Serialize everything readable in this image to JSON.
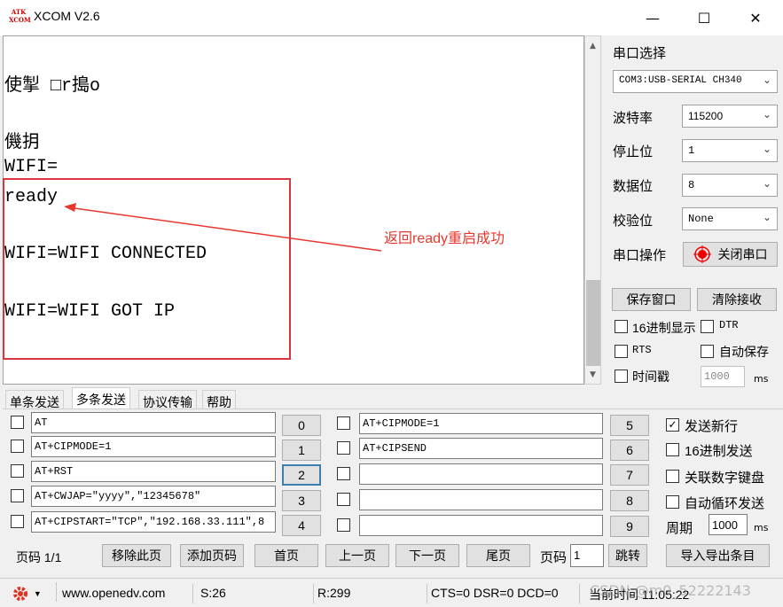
{
  "window": {
    "logo_text": "ATK\nXCOM",
    "title": "XCOM V2.6",
    "minimize": "—",
    "maximize": "☐",
    "close": "✕"
  },
  "receive": {
    "lines": [
      "使掣 □r搗o",
      "",
      "僟抈",
      "WIFI=",
      "ready",
      "",
      "WIFI=WIFI CONNECTED",
      "",
      "WIFI=WIFI GOT IP"
    ],
    "annotation": "返回ready重启成功"
  },
  "settings": {
    "port_label": "串口选择",
    "port_value": "COM3:USB-SERIAL CH340",
    "baud_label": "波特率",
    "baud_value": "115200",
    "stop_label": "停止位",
    "stop_value": "1",
    "data_label": "数据位",
    "data_value": "8",
    "parity_label": "校验位",
    "parity_value": "None",
    "op_label": "串口操作",
    "op_button": "关闭串口",
    "save_window": "保存窗口",
    "clear_recv": "清除接收",
    "hex_display": "16进制显示",
    "dtr": "DTR",
    "rts": "RTS",
    "auto_save": "自动保存",
    "timestamp": "时间戳",
    "timestamp_value": "1000",
    "ms": "ms"
  },
  "tabs": [
    "单条发送",
    "多条发送",
    "协议传输",
    "帮助"
  ],
  "multi_send": {
    "left": [
      {
        "text": "AT",
        "num": "0"
      },
      {
        "text": "AT+CIPMODE=1",
        "num": "1"
      },
      {
        "text": "AT+RST",
        "num": "2"
      },
      {
        "text": "AT+CWJAP=\"yyyy\",\"12345678\"",
        "num": "3"
      },
      {
        "text": "AT+CIPSTART=\"TCP\",\"192.168.33.111\",8",
        "num": "4"
      }
    ],
    "right": [
      {
        "text": "AT+CIPMODE=1",
        "num": "5"
      },
      {
        "text": "AT+CIPSEND",
        "num": "6"
      },
      {
        "text": "",
        "num": "7"
      },
      {
        "text": "",
        "num": "8"
      },
      {
        "text": "",
        "num": "9"
      }
    ],
    "send_newline": "发送新行",
    "hex_send": "16进制发送",
    "link_keypad": "关联数字键盘",
    "auto_loop": "自动循环发送",
    "period_label": "周期",
    "period_value": "1000",
    "ms": "ms",
    "page_label": "页码 1/1",
    "remove_page": "移除此页",
    "add_page": "添加页码",
    "first": "首页",
    "prev": "上一页",
    "next": "下一页",
    "last": "尾页",
    "page_input_label": "页码",
    "page_input_value": "1",
    "jump": "跳转",
    "import_export": "导入导出条目"
  },
  "status": {
    "url": "www.openedv.com",
    "sent": "S:26",
    "recv": "R:299",
    "lines": "CTS=0 DSR=0 DCD=0",
    "time": "当前时间 11:05:22",
    "watermark": "CSDN @m0_52222143"
  },
  "colors": {
    "accent": "#d9363e",
    "annotation": "#e8372e"
  }
}
